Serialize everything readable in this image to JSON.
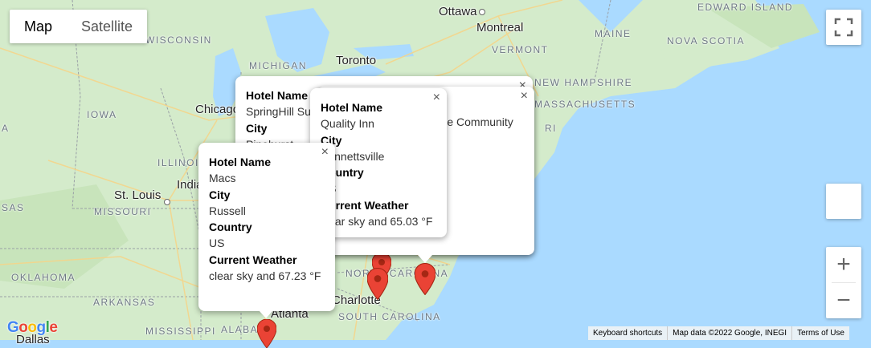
{
  "map_type": {
    "options": [
      "Map",
      "Satellite"
    ],
    "selected": "Map"
  },
  "states": [
    {
      "name": "WISCONSIN"
    },
    {
      "name": "MICHIGAN"
    },
    {
      "name": "IOWA"
    },
    {
      "name": "ILLINOIS"
    },
    {
      "name": "MISSOURI"
    },
    {
      "name": "OKLAHOMA"
    },
    {
      "name": "ARKANSAS"
    },
    {
      "name": "MISSISSIPPI"
    },
    {
      "name": "ALABAMA"
    },
    {
      "name": "SOUTH CAROLINA"
    },
    {
      "name": "NORTH CAROLINA"
    },
    {
      "name": "VERMONT"
    },
    {
      "name": "MAINE"
    },
    {
      "name": "NEW HAMPSHIRE"
    },
    {
      "name": "MASSACHUSETTS"
    },
    {
      "name": "NOVA SCOTIA"
    },
    {
      "name": "EDWARD ISLAND"
    },
    {
      "name": "SAS"
    },
    {
      "name": "A"
    },
    {
      "name": "RI"
    }
  ],
  "cities": [
    {
      "name": "Ottawa"
    },
    {
      "name": "Montreal"
    },
    {
      "name": "Toronto"
    },
    {
      "name": "Chicago"
    },
    {
      "name": "St. Louis"
    },
    {
      "name": "Atlanta"
    },
    {
      "name": "Charlotte"
    },
    {
      "name": "Dallas"
    },
    {
      "name": "Indianapolis"
    }
  ],
  "info_windows": [
    {
      "id": "springhill",
      "fields": [
        {
          "key": "Hotel Name",
          "value": "SpringHill Suites"
        },
        {
          "key": "City",
          "value": "Pinehurst"
        }
      ]
    },
    {
      "id": "community",
      "fields": [
        {
          "key": "Hotel Name",
          "value": "The Community"
        }
      ]
    },
    {
      "id": "quality-inn",
      "fields": [
        {
          "key": "Hotel Name",
          "value": "Quality Inn"
        },
        {
          "key": "City",
          "value": "Bennettsville"
        },
        {
          "key": "Country",
          "value": "US"
        },
        {
          "key": "Current Weather",
          "value": "clear sky and 65.03 °F"
        }
      ]
    },
    {
      "id": "macs",
      "fields": [
        {
          "key": "Hotel Name",
          "value": "Macs"
        },
        {
          "key": "City",
          "value": "Russell"
        },
        {
          "key": "Country",
          "value": "US"
        },
        {
          "key": "Current Weather",
          "value": "clear sky and 67.23 °F"
        }
      ]
    }
  ],
  "close_glyph": "×",
  "zoom": {
    "in": "+",
    "out": "−"
  },
  "footer": {
    "shortcuts": "Keyboard shortcuts",
    "map_data": "Map data ©2022 Google, INEGI",
    "terms": "Terms of Use"
  },
  "logo": {
    "text": "Google",
    "colors": [
      "#4285F4",
      "#EA4335",
      "#FBBC05",
      "#4285F4",
      "#34A853",
      "#EA4335"
    ]
  },
  "colors": {
    "water": "#aadaff",
    "land": "#cfe8c5",
    "marker": "#ea4335",
    "marker_dark": "#a52714"
  },
  "icons": [
    "fullscreen-icon",
    "pegman-icon",
    "close-icon",
    "map-marker-icon"
  ]
}
